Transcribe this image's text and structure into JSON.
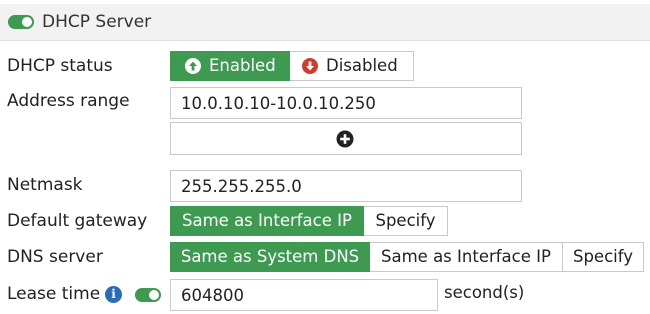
{
  "section": {
    "title": "DHCP Server",
    "enabled": true
  },
  "dhcp_status": {
    "label": "DHCP status",
    "options": [
      "Enabled",
      "Disabled"
    ],
    "selected": "Enabled"
  },
  "address_range": {
    "label": "Address range",
    "value": "10.0.10.10-10.0.10.250"
  },
  "netmask": {
    "label": "Netmask",
    "value": "255.255.255.0"
  },
  "default_gateway": {
    "label": "Default gateway",
    "options": [
      "Same as Interface IP",
      "Specify"
    ],
    "selected": "Same as Interface IP"
  },
  "dns_server": {
    "label": "DNS server",
    "options": [
      "Same as System DNS",
      "Same as Interface IP",
      "Specify"
    ],
    "selected": "Same as System DNS"
  },
  "lease_time": {
    "label": "Lease time",
    "enabled": true,
    "value": "604800",
    "unit": "second(s)"
  },
  "colors": {
    "accent": "#3d9a50",
    "info": "#2a6db5",
    "disable_icon": "#d23b2c"
  },
  "icons": {
    "enabled": "arrow-up-circle-icon",
    "disabled": "arrow-down-circle-icon",
    "add": "plus-circle-icon",
    "info": "info-icon"
  }
}
